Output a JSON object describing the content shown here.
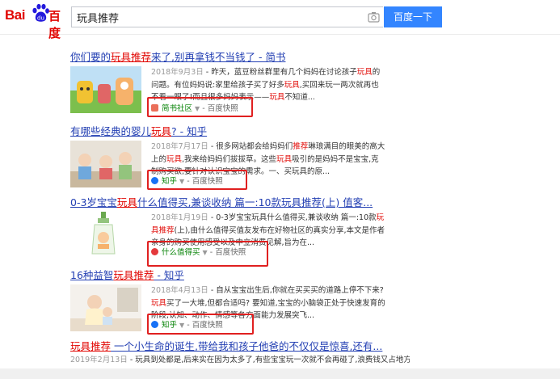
{
  "logo": {
    "text_left": "Bai",
    "text_right": "百度",
    "brand_color": "#e10602"
  },
  "search": {
    "query": "玩具推荐",
    "button_label": "百度一下",
    "camera_icon": "camera-icon"
  },
  "results": [
    {
      "title_before": "你们要的",
      "title_em": "玩具推荐",
      "title_after": "来了,别再拿钱不当钱了 - 简书",
      "date": "2018年9月3日",
      "abstract_line1": " - 昨天，蓝豆粉丝群里有几个妈妈在讨论孩子",
      "abstract_em1": "玩具",
      "abstract_line1b": "的问题。有位妈妈说:家里给孩子买了好多",
      "abstract_em2": "玩具",
      "abstract_line1c": ",买回来玩一两次就再也不看一眼了!而且很多妈妈表示——",
      "abstract_em3": "玩具",
      "abstract_line1d": "不知道...",
      "source": "简书社区",
      "source_color": "#ea6f5a",
      "snapshot": "百度快照"
    },
    {
      "title_before": "有哪些经典的婴儿",
      "title_em": "玩具",
      "title_after": "? - 知乎",
      "date": "2018年7月17日",
      "abstract_line1": " - 很多网站都会给妈妈们",
      "abstract_em1": "推荐",
      "abstract_line1b": "琳琅满目的眼美的高大上的",
      "abstract_em2": "玩具",
      "abstract_line1c": ",我来给妈妈们拔拔草。这些",
      "abstract_em3": "玩具",
      "abstract_line1d": "吸引的是妈妈不是宝宝,克制购买欲,要针对认识宝宝的需求。一、买玩具的原...",
      "source": "知乎",
      "source_color": "#1772f6",
      "snapshot": "百度快照"
    },
    {
      "title_before": "0-3岁宝宝",
      "title_em": "玩具",
      "title_after": "什么值得买,兼谈收纳 篇一:10款玩具推荐(上) 值客...",
      "date": "2018年1月19日",
      "abstract_line1": " - 0-3岁宝宝玩具什么值得买,兼谈收纳 篇一:10款",
      "abstract_em1": "玩具推荐",
      "abstract_line1b": "(上),由什么值得买值友发布在好物社区的真实分享,本文是作者亲身的购买使用感受以及中立消费见解,旨为在...",
      "abstract_em2": "",
      "abstract_line1c": "",
      "abstract_em3": "",
      "abstract_line1d": "",
      "source": "什么值得买",
      "source_color": "#e4393c",
      "snapshot": "百度快照"
    },
    {
      "title_before": "16种益智",
      "title_em": "玩具推荐",
      "title_after": " - 知乎",
      "date": "2018年4月13日",
      "abstract_line1": " - 自从宝宝出生后,你就在买买买的道路上停不下来?",
      "abstract_em1": "玩具",
      "abstract_line1b": "买了一大堆,但都合适吗? 要知道,宝宝的小脑袋正处于快速发育的阶段,认知、动作、情感等各方面能力发展突飞...",
      "abstract_em2": "",
      "abstract_line1c": "",
      "abstract_em3": "",
      "abstract_line1d": "",
      "source": "知乎",
      "source_color": "#1772f6",
      "snapshot": "百度快照"
    }
  ],
  "last_result": {
    "title_em": "玩具推荐",
    "title_after": " 一个小生命的诞生,带给我和孩子他爸的不仅仅是惊喜,还有...",
    "date": "2019年2月13日",
    "abstract": " - 玩具到处都是,后来实在因为太多了,有些宝宝玩一次就不会再碰了,浪费钱又占地方,自我反思了一下。"
  }
}
